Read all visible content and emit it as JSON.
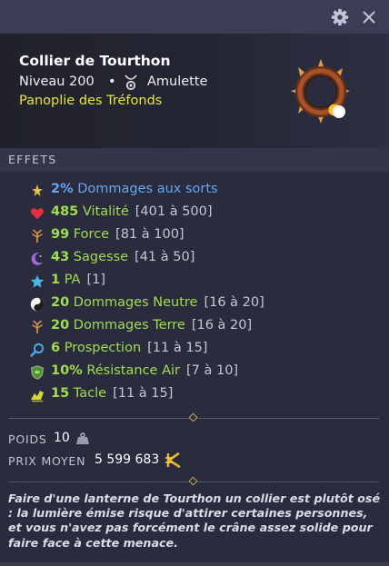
{
  "window": {
    "settings_icon": "gear-icon",
    "close_icon": "close-icon"
  },
  "item": {
    "name": "Collier de Tourthon",
    "level": "Niveau 200",
    "separator": "•",
    "type": "Amulette",
    "type_icon": "amulet-icon",
    "set": "Panoplie des Tréfonds",
    "image_icon": "spiked-collar-icon"
  },
  "effects": {
    "title": "EFFETS",
    "rows": [
      {
        "icon": "damage-spell-icon",
        "value": "2%",
        "name": "Dommages aux sorts",
        "range": ""
      },
      {
        "icon": "heart-icon",
        "value": "485",
        "name": "Vitalité",
        "range": "[401 à 500]"
      },
      {
        "icon": "earth-icon",
        "value": "99",
        "name": "Force",
        "range": "[81 à 100]"
      },
      {
        "icon": "moon-icon",
        "value": "43",
        "name": "Sagesse",
        "range": "[41 à 50]"
      },
      {
        "icon": "star-icon",
        "value": "1",
        "name": "PA",
        "range": "[1]"
      },
      {
        "icon": "yin-yang-icon",
        "value": "20",
        "name": "Dommages Neutre",
        "range": "[16 à 20]"
      },
      {
        "icon": "earth-icon",
        "value": "20",
        "name": "Dommages Terre",
        "range": "[16 à 20]"
      },
      {
        "icon": "magnifier-icon",
        "value": "6",
        "name": "Prospection",
        "range": "[11 à 15]"
      },
      {
        "icon": "shield-icon",
        "value": "10%",
        "name": "Résistance Air",
        "range": "[7 à 10]"
      },
      {
        "icon": "tackle-icon",
        "value": "15",
        "name": "Tacle",
        "range": "[11 à 15]"
      }
    ]
  },
  "stats": {
    "weight_label": "POIDS",
    "weight_value": "10",
    "weight_icon": "weight-icon",
    "price_label": "PRIX MOYEN",
    "price_value": "5 599 683",
    "price_icon": "kamas-icon"
  },
  "description": "Faire d'une lanterne de Tourthon un collier est plutôt osé : la lumière émise risque d'attirer certaines personnes, et vous n'avez pas forcément le crâne assez solide pour faire face à cette menace.",
  "colors": {
    "stat_green": "#9fdd52",
    "damage_blue": "#64a8f3",
    "set_yellow": "#e6e63c"
  }
}
